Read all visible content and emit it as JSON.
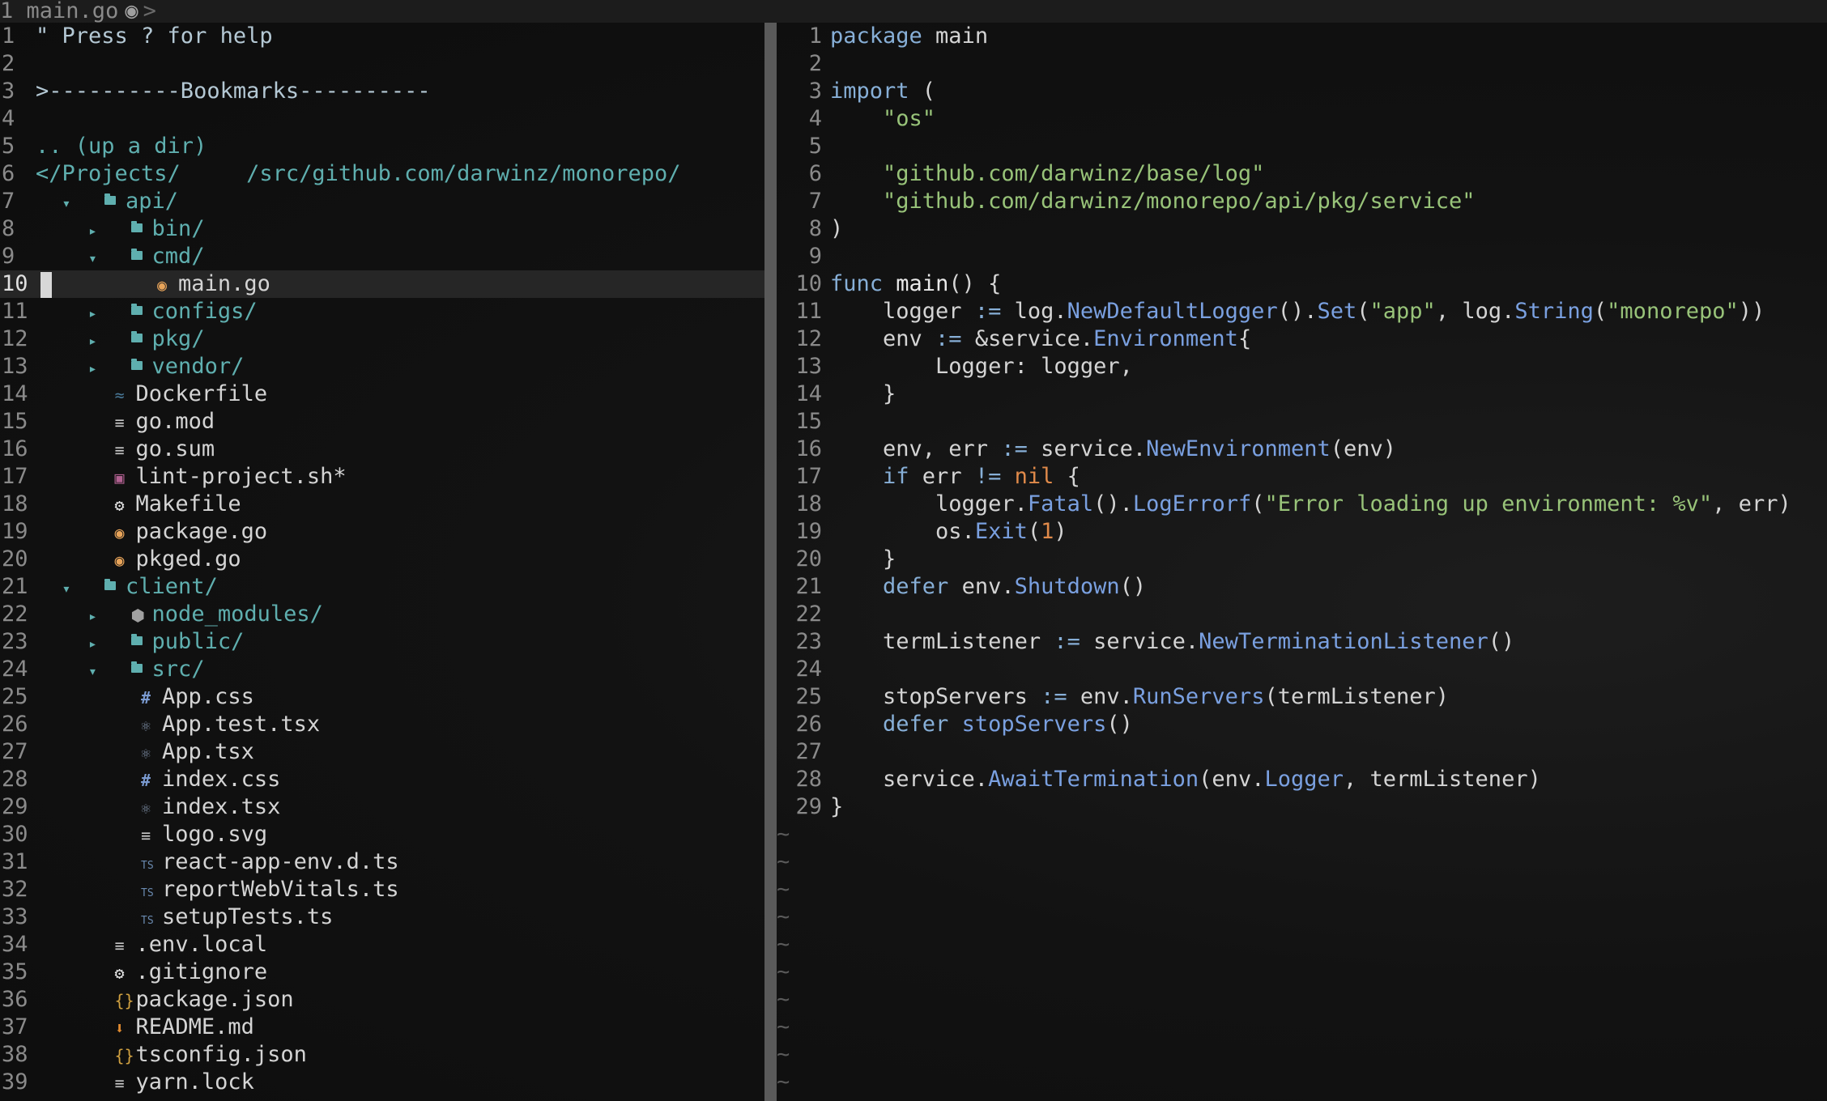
{
  "tabline": {
    "tab_number": "1",
    "tab_title": "main.go",
    "tab_icon": "go-gopher-icon",
    "separator": ">"
  },
  "tree": {
    "lines": [
      {
        "n": "1",
        "kind": "help",
        "text": "\" Press ? for help"
      },
      {
        "n": "2",
        "kind": "blank",
        "text": ""
      },
      {
        "n": "3",
        "kind": "bookmarks",
        "text": ">----------Bookmarks----------"
      },
      {
        "n": "4",
        "kind": "blank",
        "text": ""
      },
      {
        "n": "5",
        "kind": "updir",
        "text": ".. (up a dir)"
      },
      {
        "n": "6",
        "kind": "path",
        "text": "</Projects/     /src/github.com/darwinz/monorepo/"
      },
      {
        "n": "7",
        "kind": "dir",
        "depth": 0,
        "open": true,
        "text": "api/"
      },
      {
        "n": "8",
        "kind": "dir",
        "depth": 1,
        "open": false,
        "text": "bin/"
      },
      {
        "n": "9",
        "kind": "dir",
        "depth": 1,
        "open": true,
        "text": "cmd/"
      },
      {
        "n": "10",
        "kind": "file",
        "depth": 2,
        "icon": "go",
        "text": "main.go",
        "current": true
      },
      {
        "n": "11",
        "kind": "dir",
        "depth": 1,
        "open": false,
        "text": "configs/"
      },
      {
        "n": "12",
        "kind": "dir",
        "depth": 1,
        "open": false,
        "text": "pkg/"
      },
      {
        "n": "13",
        "kind": "dir",
        "depth": 1,
        "open": false,
        "text": "vendor/"
      },
      {
        "n": "14",
        "kind": "file",
        "depth": 1,
        "icon": "docker",
        "text": "Dockerfile"
      },
      {
        "n": "15",
        "kind": "file",
        "depth": 1,
        "icon": "lines",
        "text": "go.mod"
      },
      {
        "n": "16",
        "kind": "file",
        "depth": 1,
        "icon": "lines",
        "text": "go.sum"
      },
      {
        "n": "17",
        "kind": "file",
        "depth": 1,
        "icon": "shell",
        "text": "lint-project.sh*"
      },
      {
        "n": "18",
        "kind": "file",
        "depth": 1,
        "icon": "gear",
        "text": "Makefile"
      },
      {
        "n": "19",
        "kind": "file",
        "depth": 1,
        "icon": "go",
        "text": "package.go"
      },
      {
        "n": "20",
        "kind": "file",
        "depth": 1,
        "icon": "go",
        "text": "pkged.go"
      },
      {
        "n": "21",
        "kind": "dir",
        "depth": 0,
        "open": true,
        "text": "client/"
      },
      {
        "n": "22",
        "kind": "dir",
        "depth": 1,
        "open": false,
        "icon": "npm",
        "text": "node_modules/"
      },
      {
        "n": "23",
        "kind": "dir",
        "depth": 1,
        "open": false,
        "text": "public/"
      },
      {
        "n": "24",
        "kind": "dir",
        "depth": 1,
        "open": true,
        "text": "src/"
      },
      {
        "n": "25",
        "kind": "file",
        "depth": 2,
        "icon": "hash",
        "text": "App.css"
      },
      {
        "n": "26",
        "kind": "file",
        "depth": 2,
        "icon": "react",
        "text": "App.test.tsx"
      },
      {
        "n": "27",
        "kind": "file",
        "depth": 2,
        "icon": "react",
        "text": "App.tsx"
      },
      {
        "n": "28",
        "kind": "file",
        "depth": 2,
        "icon": "hash",
        "text": "index.css"
      },
      {
        "n": "29",
        "kind": "file",
        "depth": 2,
        "icon": "react",
        "text": "index.tsx"
      },
      {
        "n": "30",
        "kind": "file",
        "depth": 2,
        "icon": "lines",
        "text": "logo.svg"
      },
      {
        "n": "31",
        "kind": "file",
        "depth": 2,
        "icon": "ts",
        "text": "react-app-env.d.ts"
      },
      {
        "n": "32",
        "kind": "file",
        "depth": 2,
        "icon": "ts",
        "text": "reportWebVitals.ts"
      },
      {
        "n": "33",
        "kind": "file",
        "depth": 2,
        "icon": "ts",
        "text": "setupTests.ts"
      },
      {
        "n": "34",
        "kind": "file",
        "depth": 1,
        "icon": "lines",
        "text": ".env.local"
      },
      {
        "n": "35",
        "kind": "file",
        "depth": 1,
        "icon": "gear",
        "text": ".gitignore"
      },
      {
        "n": "36",
        "kind": "file",
        "depth": 1,
        "icon": "json",
        "text": "package.json"
      },
      {
        "n": "37",
        "kind": "file",
        "depth": 1,
        "icon": "md",
        "text": "README.md"
      },
      {
        "n": "38",
        "kind": "file",
        "depth": 1,
        "icon": "json",
        "text": "tsconfig.json"
      },
      {
        "n": "39",
        "kind": "file",
        "depth": 1,
        "icon": "lines",
        "text": "yarn.lock"
      }
    ]
  },
  "code": {
    "lines": [
      {
        "n": "1",
        "tokens": [
          [
            "kw",
            "package"
          ],
          [
            "id",
            " main"
          ]
        ]
      },
      {
        "n": "2",
        "tokens": []
      },
      {
        "n": "3",
        "tokens": [
          [
            "kw",
            "import"
          ],
          [
            "id",
            " ("
          ]
        ]
      },
      {
        "n": "4",
        "tokens": [
          [
            "id",
            "    "
          ],
          [
            "str",
            "\"os\""
          ]
        ]
      },
      {
        "n": "5",
        "tokens": []
      },
      {
        "n": "6",
        "tokens": [
          [
            "id",
            "    "
          ],
          [
            "str",
            "\"github.com/darwinz/base/log\""
          ]
        ]
      },
      {
        "n": "7",
        "tokens": [
          [
            "id",
            "    "
          ],
          [
            "str",
            "\"github.com/darwinz/monorepo/api/pkg/service\""
          ]
        ]
      },
      {
        "n": "8",
        "tokens": [
          [
            "id",
            ")"
          ]
        ]
      },
      {
        "n": "9",
        "tokens": []
      },
      {
        "n": "10",
        "tokens": [
          [
            "kw",
            "func"
          ],
          [
            "id",
            " "
          ],
          [
            "fn",
            "main"
          ],
          [
            "id",
            "() {"
          ]
        ]
      },
      {
        "n": "11",
        "tokens": [
          [
            "id",
            "    logger "
          ],
          [
            "op",
            ":="
          ],
          [
            "id",
            " log."
          ],
          [
            "method",
            "NewDefaultLogger"
          ],
          [
            "id",
            "()."
          ],
          [
            "method",
            "Set"
          ],
          [
            "id",
            "("
          ],
          [
            "str",
            "\"app\""
          ],
          [
            "id",
            ", log."
          ],
          [
            "method",
            "String"
          ],
          [
            "id",
            "("
          ],
          [
            "str",
            "\"monorepo\""
          ],
          [
            "id",
            "))"
          ]
        ]
      },
      {
        "n": "12",
        "tokens": [
          [
            "id",
            "    env "
          ],
          [
            "op",
            ":="
          ],
          [
            "id",
            " &service."
          ],
          [
            "method",
            "Environment"
          ],
          [
            "id",
            "{"
          ]
        ]
      },
      {
        "n": "13",
        "tokens": [
          [
            "id",
            "        Logger: logger,"
          ]
        ]
      },
      {
        "n": "14",
        "tokens": [
          [
            "id",
            "    }"
          ]
        ]
      },
      {
        "n": "15",
        "tokens": []
      },
      {
        "n": "16",
        "tokens": [
          [
            "id",
            "    env, err "
          ],
          [
            "op",
            ":="
          ],
          [
            "id",
            " service."
          ],
          [
            "method",
            "NewEnvironment"
          ],
          [
            "id",
            "(env)"
          ]
        ]
      },
      {
        "n": "17",
        "tokens": [
          [
            "id",
            "    "
          ],
          [
            "kw",
            "if"
          ],
          [
            "id",
            " err "
          ],
          [
            "op",
            "!="
          ],
          [
            "id",
            " "
          ],
          [
            "nil",
            "nil"
          ],
          [
            "id",
            " {"
          ]
        ]
      },
      {
        "n": "18",
        "tokens": [
          [
            "id",
            "        logger."
          ],
          [
            "method",
            "Fatal"
          ],
          [
            "id",
            "()."
          ],
          [
            "method",
            "LogErrorf"
          ],
          [
            "id",
            "("
          ],
          [
            "str",
            "\"Error loading up environment: %v\""
          ],
          [
            "id",
            ", err)"
          ]
        ]
      },
      {
        "n": "19",
        "tokens": [
          [
            "id",
            "        os."
          ],
          [
            "method",
            "Exit"
          ],
          [
            "id",
            "("
          ],
          [
            "num",
            "1"
          ],
          [
            "id",
            ")"
          ]
        ]
      },
      {
        "n": "20",
        "tokens": [
          [
            "id",
            "    }"
          ]
        ]
      },
      {
        "n": "21",
        "tokens": [
          [
            "id",
            "    "
          ],
          [
            "kw",
            "defer"
          ],
          [
            "id",
            " env."
          ],
          [
            "method",
            "Shutdown"
          ],
          [
            "id",
            "()"
          ]
        ]
      },
      {
        "n": "22",
        "tokens": []
      },
      {
        "n": "23",
        "tokens": [
          [
            "id",
            "    termListener "
          ],
          [
            "op",
            ":="
          ],
          [
            "id",
            " service."
          ],
          [
            "method",
            "NewTerminationListener"
          ],
          [
            "id",
            "()"
          ]
        ]
      },
      {
        "n": "24",
        "tokens": []
      },
      {
        "n": "25",
        "tokens": [
          [
            "id",
            "    stopServers "
          ],
          [
            "op",
            ":="
          ],
          [
            "id",
            " env."
          ],
          [
            "method",
            "RunServers"
          ],
          [
            "id",
            "(termListener)"
          ]
        ]
      },
      {
        "n": "26",
        "tokens": [
          [
            "id",
            "    "
          ],
          [
            "kw",
            "defer"
          ],
          [
            "id",
            " "
          ],
          [
            "method",
            "stopServers"
          ],
          [
            "id",
            "()"
          ]
        ]
      },
      {
        "n": "27",
        "tokens": []
      },
      {
        "n": "28",
        "tokens": [
          [
            "id",
            "    service."
          ],
          [
            "method",
            "AwaitTermination"
          ],
          [
            "id",
            "(env."
          ],
          [
            "method",
            "Logger"
          ],
          [
            "id",
            ", termListener)"
          ]
        ]
      },
      {
        "n": "29",
        "tokens": [
          [
            "id",
            "}"
          ]
        ]
      }
    ],
    "tilde_count": 10,
    "tilde_char": "~"
  },
  "colors": {
    "tree_dir": "#5fafaf",
    "keyword": "#87afd7",
    "string": "#98c379",
    "method": "#7aa0e0",
    "nil": "#e08a4a",
    "divider": "#5a5a5a"
  }
}
